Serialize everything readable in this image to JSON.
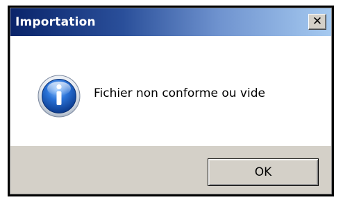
{
  "dialog": {
    "title": "Importation",
    "close_glyph": "✕",
    "close_icon": "close-icon",
    "message": "Fichier non conforme ou vide",
    "message_icon": "info-icon",
    "ok_label": "OK"
  },
  "colors": {
    "titlebar_start": "#0a246a",
    "titlebar_end": "#a6caf0",
    "footer_bg": "#d4d0c8",
    "icon_blue": "#1f5fbf"
  }
}
